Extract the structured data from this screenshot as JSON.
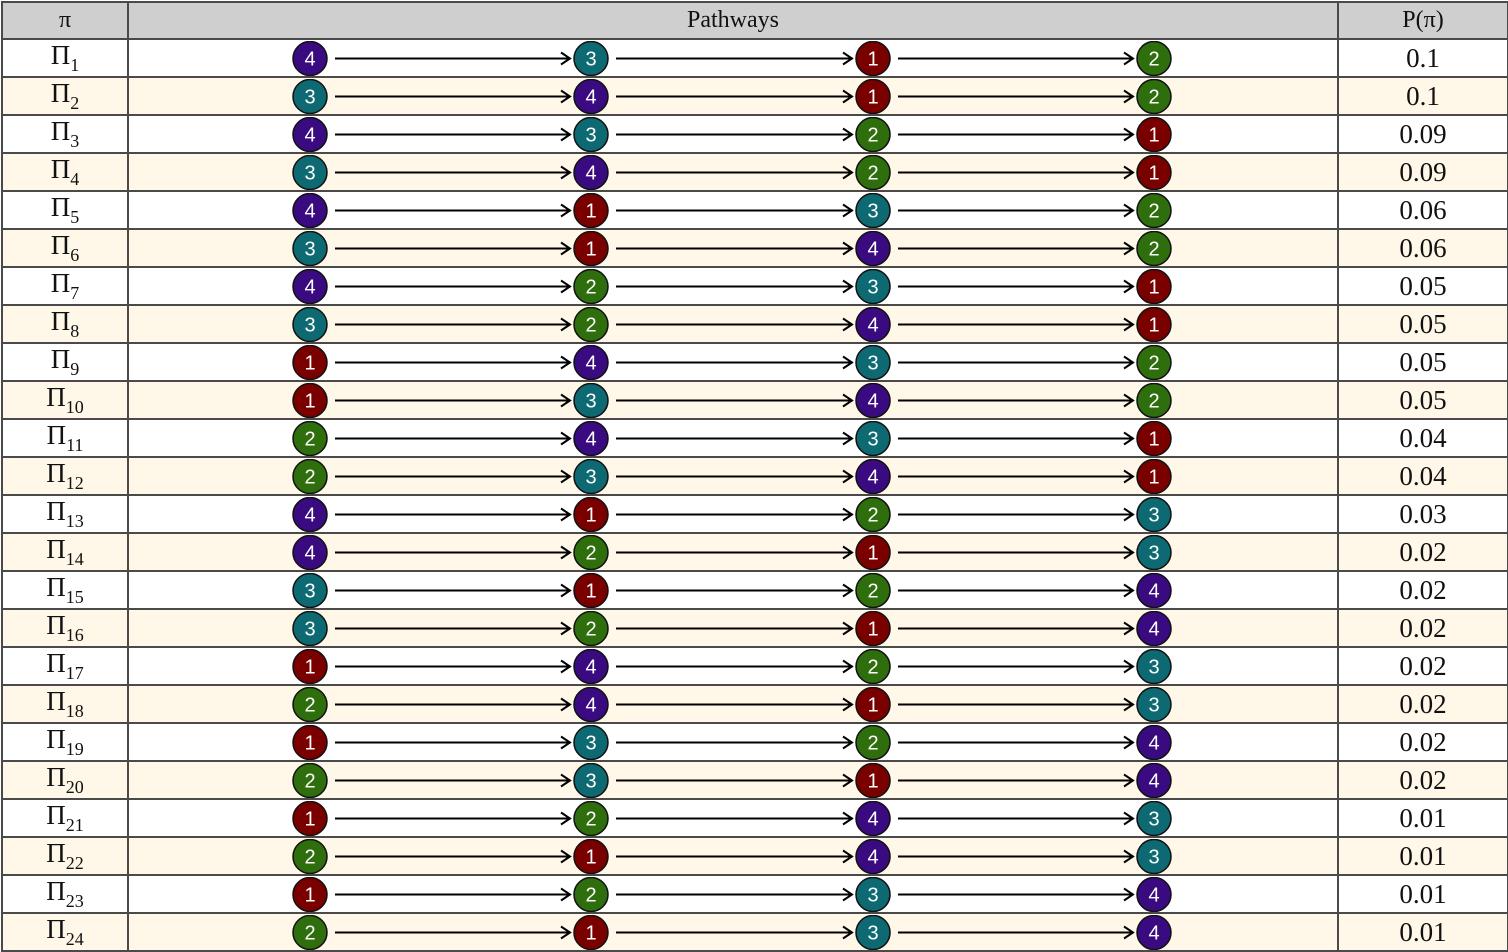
{
  "header": {
    "col_pi": "π",
    "col_pathways": "Pathways",
    "col_prob": "P(π)"
  },
  "node_colors": {
    "1": "#7a0000",
    "2": "#2e6e0c",
    "3": "#0d6a72",
    "4": "#3a0a80"
  },
  "row_colors": {
    "odd": "#ffffff",
    "even": "#fff7e8"
  },
  "rows": [
    {
      "symbol": "Π",
      "sub": "1",
      "path": [
        4,
        3,
        1,
        2
      ],
      "prob": "0.1"
    },
    {
      "symbol": "Π",
      "sub": "2",
      "path": [
        3,
        4,
        1,
        2
      ],
      "prob": "0.1"
    },
    {
      "symbol": "Π",
      "sub": "3",
      "path": [
        4,
        3,
        2,
        1
      ],
      "prob": "0.09"
    },
    {
      "symbol": "Π",
      "sub": "4",
      "path": [
        3,
        4,
        2,
        1
      ],
      "prob": "0.09"
    },
    {
      "symbol": "Π",
      "sub": "5",
      "path": [
        4,
        1,
        3,
        2
      ],
      "prob": "0.06"
    },
    {
      "symbol": "Π",
      "sub": "6",
      "path": [
        3,
        1,
        4,
        2
      ],
      "prob": "0.06"
    },
    {
      "symbol": "Π",
      "sub": "7",
      "path": [
        4,
        2,
        3,
        1
      ],
      "prob": "0.05"
    },
    {
      "symbol": "Π",
      "sub": "8",
      "path": [
        3,
        2,
        4,
        1
      ],
      "prob": "0.05"
    },
    {
      "symbol": "Π",
      "sub": "9",
      "path": [
        1,
        4,
        3,
        2
      ],
      "prob": "0.05"
    },
    {
      "symbol": "Π",
      "sub": "10",
      "path": [
        1,
        3,
        4,
        2
      ],
      "prob": "0.05"
    },
    {
      "symbol": "Π",
      "sub": "11",
      "path": [
        2,
        4,
        3,
        1
      ],
      "prob": "0.04"
    },
    {
      "symbol": "Π",
      "sub": "12",
      "path": [
        2,
        3,
        4,
        1
      ],
      "prob": "0.04"
    },
    {
      "symbol": "Π",
      "sub": "13",
      "path": [
        4,
        1,
        2,
        3
      ],
      "prob": "0.03"
    },
    {
      "symbol": "Π",
      "sub": "14",
      "path": [
        4,
        2,
        1,
        3
      ],
      "prob": "0.02"
    },
    {
      "symbol": "Π",
      "sub": "15",
      "path": [
        3,
        1,
        2,
        4
      ],
      "prob": "0.02"
    },
    {
      "symbol": "Π",
      "sub": "16",
      "path": [
        3,
        2,
        1,
        4
      ],
      "prob": "0.02"
    },
    {
      "symbol": "Π",
      "sub": "17",
      "path": [
        1,
        4,
        2,
        3
      ],
      "prob": "0.02"
    },
    {
      "symbol": "Π",
      "sub": "18",
      "path": [
        2,
        4,
        1,
        3
      ],
      "prob": "0.02"
    },
    {
      "symbol": "Π",
      "sub": "19",
      "path": [
        1,
        3,
        2,
        4
      ],
      "prob": "0.02"
    },
    {
      "symbol": "Π",
      "sub": "20",
      "path": [
        2,
        3,
        1,
        4
      ],
      "prob": "0.02"
    },
    {
      "symbol": "Π",
      "sub": "21",
      "path": [
        1,
        2,
        4,
        3
      ],
      "prob": "0.01"
    },
    {
      "symbol": "Π",
      "sub": "22",
      "path": [
        2,
        1,
        4,
        3
      ],
      "prob": "0.01"
    },
    {
      "symbol": "Π",
      "sub": "23",
      "path": [
        1,
        2,
        3,
        4
      ],
      "prob": "0.01"
    },
    {
      "symbol": "Π",
      "sub": "24",
      "path": [
        2,
        1,
        3,
        4
      ],
      "prob": "0.01"
    }
  ]
}
